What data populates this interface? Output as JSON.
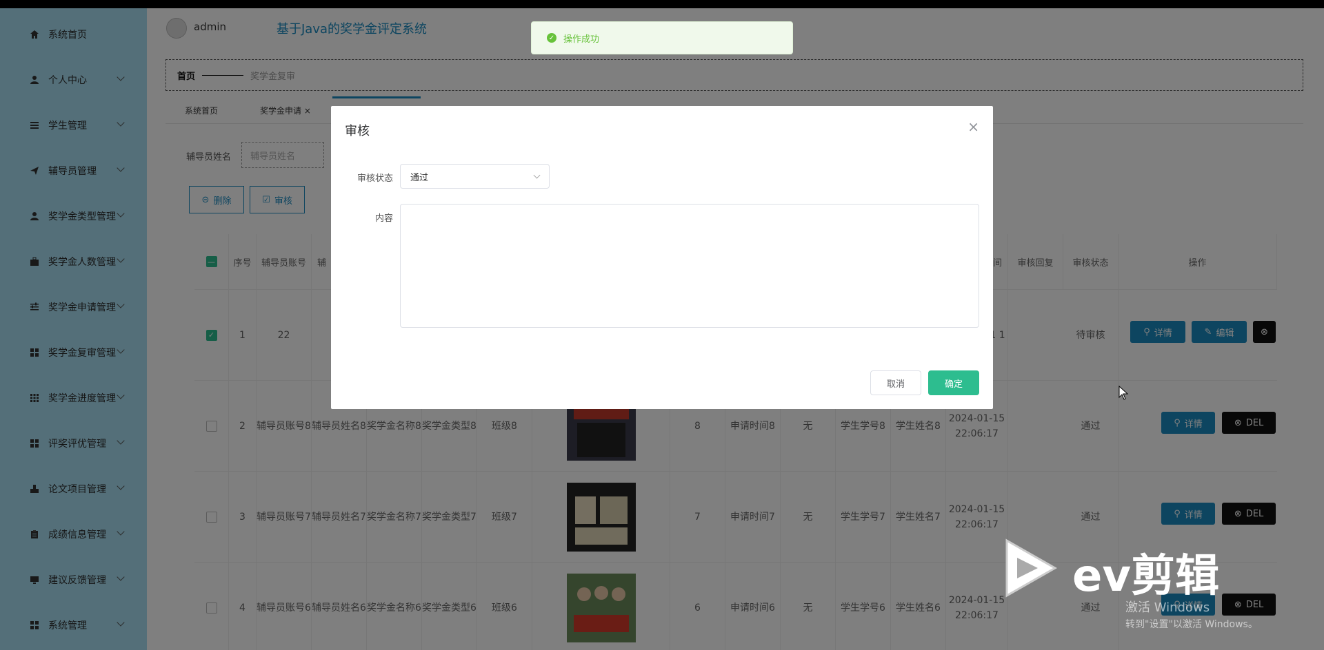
{
  "header": {
    "admin_name": "admin",
    "system_title": "基于Java的奖学金评定系统"
  },
  "sidebar": {
    "items": [
      {
        "label": "系统首页",
        "icon": "home-icon"
      },
      {
        "label": "个人中心",
        "icon": "user-icon"
      },
      {
        "label": "学生管理",
        "icon": "list-icon"
      },
      {
        "label": "辅导员管理",
        "icon": "send-icon"
      },
      {
        "label": "奖学金类型管理",
        "icon": "user-icon"
      },
      {
        "label": "奖学金人数管理",
        "icon": "briefcase-icon"
      },
      {
        "label": "奖学金申请管理",
        "icon": "sliders-icon"
      },
      {
        "label": "奖学金复审管理",
        "icon": "grid-icon"
      },
      {
        "label": "奖学金进度管理",
        "icon": "grid9-icon"
      },
      {
        "label": "评奖评优管理",
        "icon": "grid-icon"
      },
      {
        "label": "论文项目管理",
        "icon": "stamp-icon"
      },
      {
        "label": "成绩信息管理",
        "icon": "clipboard-icon"
      },
      {
        "label": "建议反馈管理",
        "icon": "monitor-icon"
      },
      {
        "label": "系统管理",
        "icon": "grid-icon"
      }
    ]
  },
  "breadcrumb": {
    "home": "首页",
    "current": "奖学金复审"
  },
  "tabs": [
    {
      "label": "系统首页"
    },
    {
      "label": "奖学金申请 ×"
    }
  ],
  "filter": {
    "label": "辅导员姓名",
    "placeholder": "辅导员姓名"
  },
  "toolbar": {
    "delete_label": "删除",
    "review_label": "审核"
  },
  "table": {
    "headers": {
      "index": "序号",
      "counselor_account": "辅导员账号",
      "counselor_partial": "辅",
      "time_partial": "间",
      "reply": "审核回复",
      "status": "审核状态",
      "actions": "操作"
    },
    "rows": [
      {
        "idx": "1",
        "account": "22",
        "time_partial": "1\n1",
        "status": "待审核"
      },
      {
        "idx": "2",
        "account": "辅导员账号8",
        "name": "辅导员姓名8",
        "sname": "奖学金名称8",
        "stype": "奖学金类型8",
        "class": "班级8",
        "num": "8",
        "apply": "申请时间8",
        "none": "无",
        "sno": "学生学号8",
        "sname2": "学生姓名8",
        "time": "2024-01-15 22:06:17",
        "status": "通过"
      },
      {
        "idx": "3",
        "account": "辅导员账号7",
        "name": "辅导员姓名7",
        "sname": "奖学金名称7",
        "stype": "奖学金类型7",
        "class": "班级7",
        "num": "7",
        "apply": "申请时间7",
        "none": "无",
        "sno": "学生学号7",
        "sname2": "学生姓名7",
        "time": "2024-01-15 22:06:17",
        "status": "通过"
      },
      {
        "idx": "4",
        "account": "辅导员账号6",
        "name": "辅导员姓名6",
        "sname": "奖学金名称6",
        "stype": "奖学金类型6",
        "class": "班级6",
        "num": "6",
        "apply": "申请时间6",
        "none": "无",
        "sno": "学生学号6",
        "sname2": "学生姓名6",
        "time": "2024-01-15 22:06:17",
        "status": "通过"
      }
    ],
    "btn_detail": "详情",
    "btn_edit": "编辑",
    "btn_del": "DEL"
  },
  "toast": {
    "message": "操作成功"
  },
  "modal": {
    "title": "审核",
    "status_label": "审核状态",
    "status_value": "通过",
    "content_label": "内容",
    "content_value": "",
    "cancel": "取消",
    "confirm": "确定"
  },
  "watermark": {
    "brand": "ev剪辑",
    "activate_line1": "激活 Windows",
    "activate_line2": "转到\"设置\"以激活 Windows。"
  },
  "colors": {
    "sidebar_bg": "#a9dff2",
    "accent": "#1a8bc0",
    "confirm": "#2dbd8f",
    "toast_text": "#67c23a"
  }
}
